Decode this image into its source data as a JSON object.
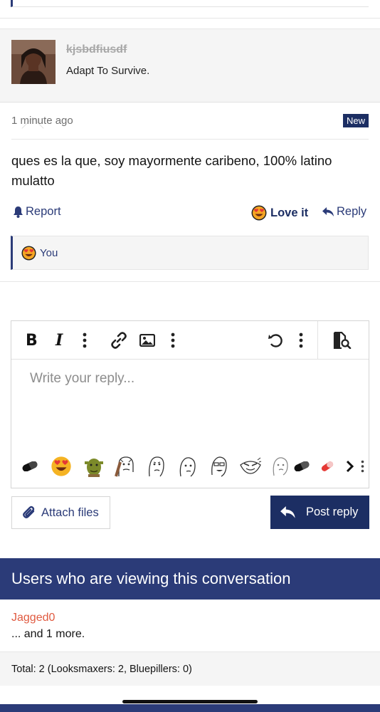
{
  "post": {
    "username": "kjsbdfiusdf",
    "user_title": "Adapt To Survive.",
    "time": "1 minute ago",
    "badge": "New",
    "body": "ques es la que, soy mayormente caribeno, 100% latino mulatto",
    "actions": {
      "report": "Report",
      "love": "Love it",
      "reply": "Reply"
    },
    "reactions_by": "You"
  },
  "editor": {
    "placeholder": "Write your reply...",
    "toolbar_icons": [
      "bold-icon",
      "italic-icon",
      "more-vertical-icon",
      "link-icon",
      "image-icon",
      "more-vertical-icon",
      "undo-icon",
      "more-vertical-icon",
      "preview-icon"
    ],
    "smilies": [
      "pill-icon",
      "heart-eyes-emoji",
      "shrek-smilie",
      "meme-face-smilie",
      "meme-face-smilie",
      "meme-face-smilie",
      "meme-face-smilie",
      "meme-face-smilie",
      "meme-face-smilie",
      "pill-icon",
      "pill-icon",
      "chevron-right-icon",
      "more-vertical-icon"
    ]
  },
  "buttons": {
    "attach": "Attach files",
    "post_reply": "Post reply"
  },
  "viewers": {
    "title": "Users who are viewing this conversation",
    "user": "Jagged0",
    "more": "... and 1 more.",
    "total": "Total: 2 (Looksmaxers: 2, Bluepillers: 0)"
  },
  "colors": {
    "primary": "#2b3b78",
    "primary_dark": "#1c2e63",
    "viewer_name": "#e05a40"
  }
}
